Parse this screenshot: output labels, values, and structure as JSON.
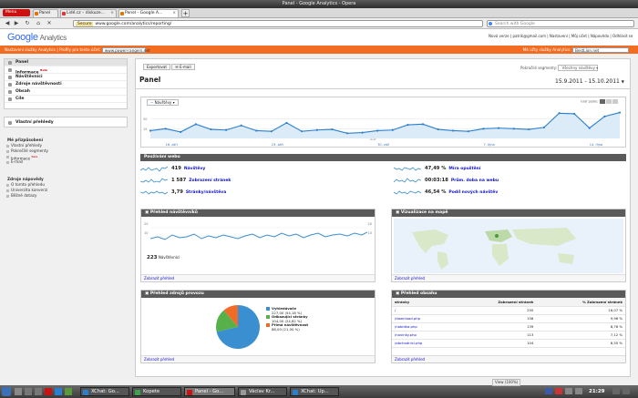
{
  "window": {
    "title": "Panel - Google Analytics - Opera"
  },
  "browser": {
    "menu_label": "Menu",
    "tabs": [
      {
        "label": "Panel"
      },
      {
        "label": "Lidé.cz – diskuze..."
      },
      {
        "label": "Panel - Google A..."
      }
    ],
    "secure_label": "Secure",
    "url": "www.google.com/analytics/reporting/",
    "search_placeholder": "Search with Google",
    "new_tab": "+"
  },
  "ga": {
    "logo_google": "Google",
    "logo_analytics": "Analytics",
    "user_bar": "Nová verze | patrik@gmail.com | Nastavení | Můj účet | Nápověda | Odhlásit se",
    "orange": {
      "all_accounts": "Nastavení služby Analytics",
      "separator": "|",
      "profiles_label": "Profily pro tento účet:",
      "selected_profile": "www.power-rangers.net",
      "right_label": "Mé účty služby Analytics:",
      "right_value": "BestLion.net"
    }
  },
  "sidebar": {
    "items": [
      {
        "label": "Panel"
      },
      {
        "label": "Informace",
        "badge": "Beta"
      },
      {
        "label": "Návštěvníci"
      },
      {
        "label": "Zdroje návštěvnosti"
      },
      {
        "label": "Obsah"
      },
      {
        "label": "Cíle"
      }
    ],
    "custom_reports": "Vlastní přehledy",
    "customization": {
      "title": "Mé přizpůsobení",
      "items": [
        "Vlastní přehledy",
        "Pokročilé segmenty",
        "Informace",
        "E-mail"
      ],
      "badge": "Beta"
    },
    "help": {
      "title": "Zdroje nápovědy",
      "items": [
        "O tomto přehledu",
        "Univerzita konverzí",
        "Běžné dotazy"
      ]
    }
  },
  "toolbar": {
    "export": "Exportovat",
    "email": "E-mail",
    "segments_label": "Pokročilé segmenty:",
    "segments_value": "Všechny návštěvy"
  },
  "dashboard": {
    "title": "Panel",
    "date_range": "15.9.2011 - 15.10.2011",
    "metric_select": "Návštěvy",
    "graph_by": "Graf podle:",
    "y_ticks": [
      "30",
      "15"
    ],
    "x_ticks": [
      "16. září",
      "23. září",
      "30. září",
      "7. října",
      "14. října"
    ],
    "callout": "Graf"
  },
  "usage": {
    "title": "Používání webu",
    "metrics": [
      {
        "value": "419",
        "label": "Návštěvy"
      },
      {
        "value": "1 587",
        "label": "Zobrazení stránek"
      },
      {
        "value": "3,79",
        "label": "Stránky/návštěva"
      },
      {
        "value": "47,49 %",
        "label": "Míra opuštění"
      },
      {
        "value": "00:03:18",
        "label": "Prům. doba na webu"
      },
      {
        "value": "46,54 %",
        "label": "Podíl nových návštěv"
      }
    ]
  },
  "visitors_panel": {
    "title": "Přehled návštěvníků",
    "y_ticks": [
      "20",
      "10"
    ],
    "right_ticks": [
      "20",
      "10"
    ],
    "total": "223",
    "total_label": "Návštěvníci",
    "footer": "Zobrazit přehled"
  },
  "map_panel": {
    "title": "Vizualizace na mapě",
    "footer": "Zobrazit přehled"
  },
  "traffic_panel": {
    "title": "Přehled zdrojů provozu",
    "legend": [
      {
        "label": "Vyhledávače",
        "sub": "227,00 (54,18 %)",
        "color": "#3a8fd0"
      },
      {
        "label": "Odkazující stránky",
        "sub": "104,00 (24,82 %)",
        "color": "#57b04a"
      },
      {
        "label": "Přímá návštěvnost",
        "sub": "88,00 (21,00 %)",
        "color": "#f06b28"
      }
    ],
    "footer": "Zobrazit přehled"
  },
  "content_panel": {
    "title": "Přehled obsahu",
    "headers": [
      "stránky",
      "Zobrazení stránek",
      "% Zobrazení stránek"
    ],
    "rows": [
      [
        "/",
        "250",
        "16,07 %"
      ],
      [
        "/download.php",
        "158",
        "9,96 %"
      ],
      [
        "/nabidka.php",
        "139",
        "8,76 %"
      ],
      [
        "/novinky.php",
        "113",
        "7,12 %"
      ],
      [
        "/obchodnici.php",
        "104",
        "6,55 %"
      ]
    ],
    "footer": "Zobrazit přehled"
  },
  "chart_data": {
    "type": "line",
    "title": "",
    "ylabel": "",
    "xlabel": "",
    "ylim": [
      0,
      45
    ],
    "x_tick_labels": [
      "16. září",
      "23. září",
      "30. září",
      "7. října",
      "14. října"
    ],
    "series": [
      {
        "name": "Návštěvy",
        "values": [
          12,
          15,
          10,
          22,
          14,
          13,
          20,
          12,
          11,
          24,
          11,
          13,
          14,
          8,
          9,
          12,
          13,
          21,
          22,
          14,
          12,
          11,
          15,
          16,
          15,
          14,
          17,
          39,
          38,
          16,
          34,
          40
        ]
      }
    ]
  },
  "taskbar": {
    "tasks": [
      {
        "label": "XChat: Go...",
        "color": "#2b7fcf"
      },
      {
        "label": "Kopete",
        "color": "#3fa34d"
      },
      {
        "label": "Panel - Go...",
        "color": "#c11"
      },
      {
        "label": "Václav Kr...",
        "color": "#999"
      },
      {
        "label": "XChat: Up...",
        "color": "#2b7fcf"
      }
    ],
    "zoom": "View (100%)",
    "clock": "21:29"
  }
}
